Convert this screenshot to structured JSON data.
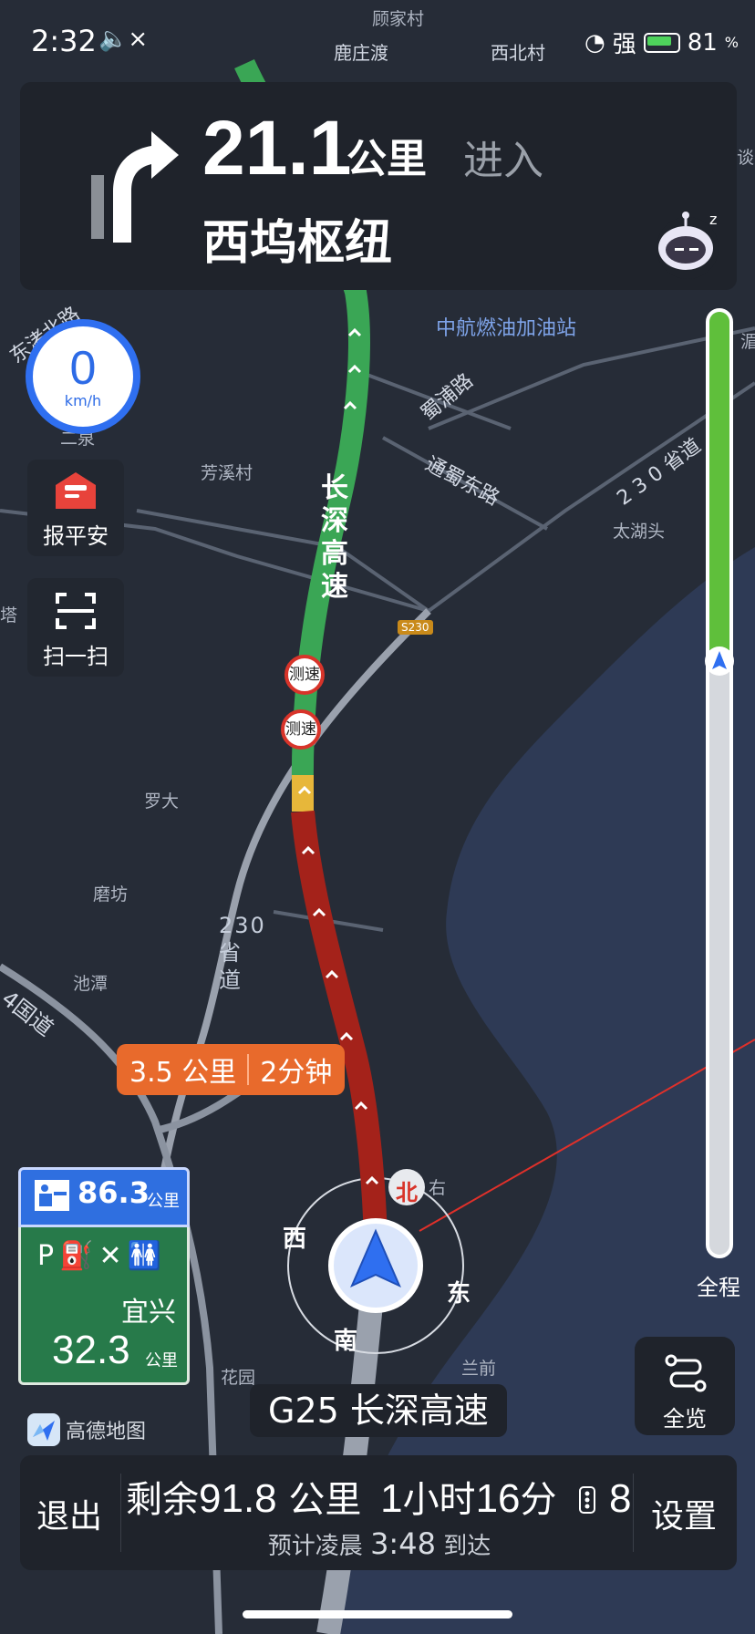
{
  "status_bar": {
    "time": "2:32",
    "mute_icon": "×",
    "signal_label": "强",
    "battery_level": "81",
    "battery_unit": "%"
  },
  "instruction": {
    "distance": "21.1",
    "distance_unit": "公里",
    "action": "进入",
    "road": "西坞枢纽",
    "turn_icon": "turn-right-arrow"
  },
  "speed": {
    "value": "0",
    "unit": "km/h"
  },
  "side_buttons": [
    {
      "label": "报平安",
      "icon": "mail-icon"
    },
    {
      "label": "扫一扫",
      "icon": "scan-icon"
    }
  ],
  "map": {
    "labels": [
      "鹿庄渡",
      "顾家村",
      "西北村",
      "中航燃油加油站",
      "蜀浦路",
      "通蜀东路",
      "2 3 0 省道",
      "芳溪村",
      "太湖头",
      "罗大",
      "磨坊",
      "池潭",
      "东渚北路",
      "谈",
      "湄",
      "塔",
      "二泉",
      "花园",
      "兰前",
      "右",
      "4国道"
    ],
    "road_name_vertical": "长深高速",
    "road_230_vertical": "230省道",
    "shield": "S230",
    "cameras": [
      "测速",
      "测速"
    ],
    "compass": {
      "north": "北",
      "south": "南",
      "east": "东",
      "west": "西"
    }
  },
  "route_progress": {
    "fraction_done": 0.37,
    "label": "全程"
  },
  "service_sign": {
    "distance": "86.3",
    "distance_unit": "公里",
    "city": "宜兴",
    "city_distance": "32.3",
    "city_unit": "公里"
  },
  "traffic_callout": {
    "distance": "3.5 公里",
    "time": "2分钟"
  },
  "overview_button": {
    "label": "全览"
  },
  "current_road": "G25 长深高速",
  "brand": "高德地图",
  "bottom_bar": {
    "exit_label": "退出",
    "settings_label": "设置",
    "remaining_label": "剩余",
    "remaining_distance": "91.8",
    "remaining_unit": "公里",
    "remaining_hours": "1",
    "hours_unit": "小时",
    "remaining_minutes": "16",
    "minutes_unit": "分",
    "traffic_lights": "8",
    "eta_prefix": "预计凌晨",
    "eta_time": "3:48",
    "eta_suffix": "到达"
  },
  "colors": {
    "map_bg": "#242a35",
    "route_green": "#3aa655",
    "route_red": "#a4221a",
    "route_yellow": "#e7b73a",
    "accent_blue": "#2f6ff0",
    "callout_orange": "#e86a2c",
    "progress_green": "#5fbf3b"
  }
}
